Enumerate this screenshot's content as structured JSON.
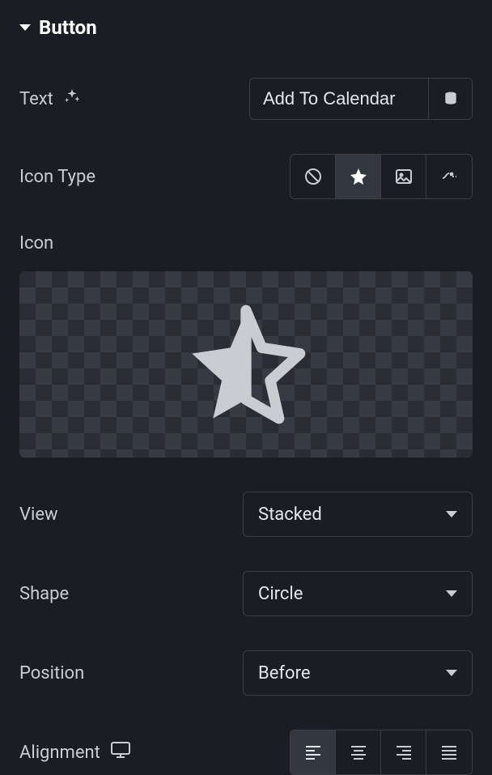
{
  "section": {
    "title": "Button"
  },
  "text": {
    "label": "Text",
    "value": "Add To Calendar"
  },
  "icon_type": {
    "label": "Icon Type",
    "selected": "icon"
  },
  "icon": {
    "label": "Icon",
    "name": "star-half"
  },
  "view": {
    "label": "View",
    "value": "Stacked"
  },
  "shape": {
    "label": "Shape",
    "value": "Circle"
  },
  "position": {
    "label": "Position",
    "value": "Before"
  },
  "alignment": {
    "label": "Alignment",
    "selected": "left"
  }
}
